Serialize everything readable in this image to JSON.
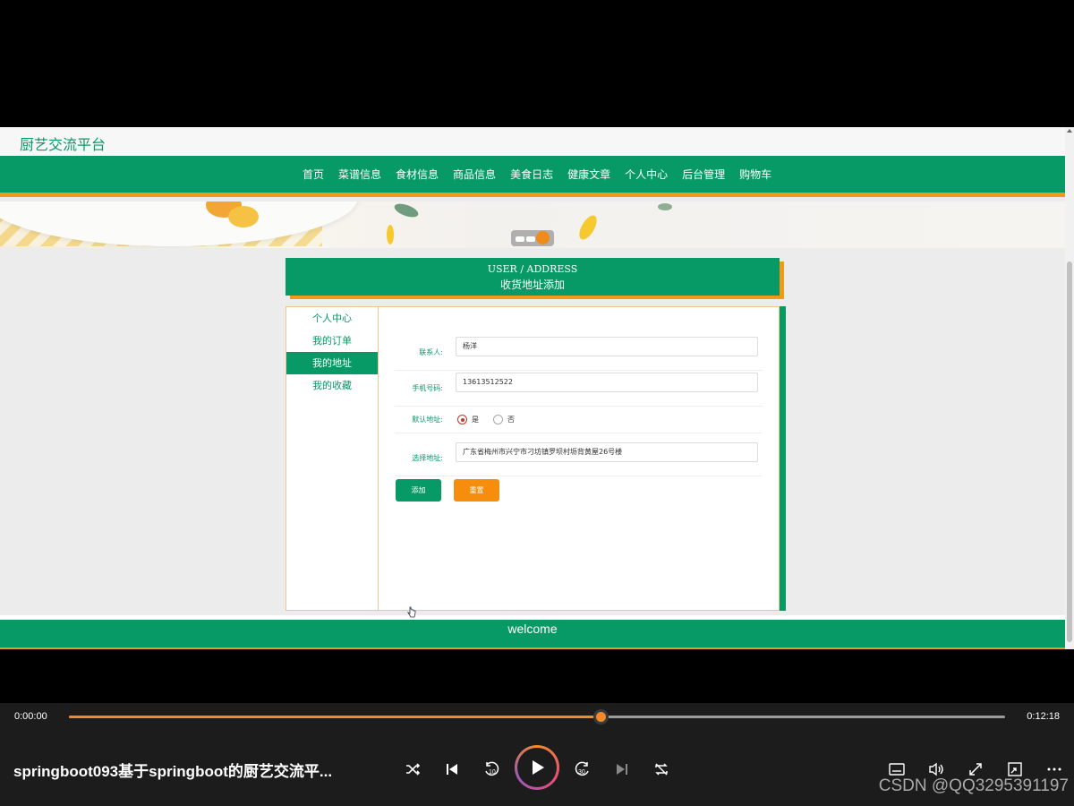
{
  "site": {
    "title": "厨艺交流平台",
    "nav": [
      "首页",
      "菜谱信息",
      "食材信息",
      "商品信息",
      "美食日志",
      "健康文章",
      "个人中心",
      "后台管理",
      "购物车"
    ]
  },
  "page_header": {
    "en": "USER / ADDRESS",
    "cn": "收货地址添加"
  },
  "side_menu": {
    "items": [
      "个人中心",
      "我的订单",
      "我的地址",
      "我的收藏"
    ],
    "active": "我的地址"
  },
  "form": {
    "contact_label": "联系人:",
    "contact_value": "杨洋",
    "phone_label": "手机号码:",
    "phone_value": "13613512522",
    "default_label": "默认地址:",
    "default_yes": "是",
    "default_no": "否",
    "default_selected": "是",
    "address_label": "选择地址:",
    "address_value": "广东省梅州市兴宁市刁坊镇罗坝村坜背黄屋26号楼",
    "add_button": "添加",
    "reset_button": "重置"
  },
  "footer": {
    "text": "welcome"
  },
  "player": {
    "current_time": "0:00:00",
    "total_time": "0:12:18",
    "progress": 0.568,
    "video_title": "springboot093基于springboot的厨艺交流平...",
    "watermark": "CSDN @QQ3295391197",
    "controls": [
      "shuffle-icon",
      "previous-icon",
      "rewind-10-icon",
      "play-icon",
      "forward-30-icon",
      "next-icon",
      "repeat-icon",
      "subtitles-icon",
      "volume-icon",
      "fullscreen-icon",
      "miniplayer-icon",
      "more-icon"
    ]
  },
  "colors": {
    "primary": "#079a67",
    "accent": "#f09a18",
    "reset_button": "#f68d0d",
    "progress": "#f08a2c"
  }
}
